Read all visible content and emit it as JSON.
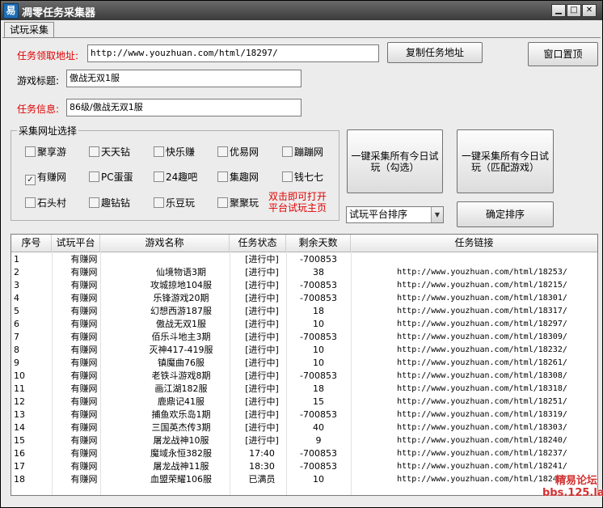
{
  "window": {
    "title": "凋零任务采集器",
    "app_icon_glyph": "易"
  },
  "tabs": [
    {
      "label": "试玩采集"
    }
  ],
  "form": {
    "task_url_label": "任务领取地址:",
    "task_url_value": "http://www.youzhuan.com/html/18297/",
    "copy_task_url_button": "复制任务地址",
    "window_topmost_button": "窗口置顶",
    "game_title_label": "游戏标题:",
    "game_title_value": "傲战无双1服",
    "task_info_label": "任务信息:",
    "task_info_value": "86级/傲战无双1服"
  },
  "site_group": {
    "title": "采集网址选择",
    "checkboxes": [
      {
        "label": "聚享游",
        "checked": false
      },
      {
        "label": "天天钻",
        "checked": false
      },
      {
        "label": "快乐赚",
        "checked": false
      },
      {
        "label": "优易网",
        "checked": false
      },
      {
        "label": "蹦蹦网",
        "checked": false
      },
      {
        "label": "有赚网",
        "checked": true
      },
      {
        "label": "PC蛋蛋",
        "checked": false
      },
      {
        "label": "24趣吧",
        "checked": false
      },
      {
        "label": "集趣网",
        "checked": false
      },
      {
        "label": "钱七七",
        "checked": false
      },
      {
        "label": "石头村",
        "checked": false
      },
      {
        "label": "趣钻钻",
        "checked": false
      },
      {
        "label": "乐豆玩",
        "checked": false
      },
      {
        "label": "聚聚玩",
        "checked": false
      }
    ],
    "hint_line1": "双击即可打开",
    "hint_line2": "平台试玩主页"
  },
  "actions": {
    "collect_checked_line1": "一键采集所有今日试",
    "collect_checked_line2": "玩（勾选）",
    "collect_matched_line1": "一键采集所有今日试",
    "collect_matched_line2": "玩（匹配游戏）",
    "sort_select_value": "试玩平台排序",
    "confirm_sort_button": "确定排序"
  },
  "table": {
    "columns": [
      "序号",
      "试玩平台",
      "游戏名称",
      "任务状态",
      "剩余天数",
      "任务链接"
    ],
    "rows": [
      [
        "1",
        "有赚网",
        "",
        "[进行中]",
        "-700853",
        ""
      ],
      [
        "2",
        "有赚网",
        "仙境物语3期",
        "[进行中]",
        "38",
        "http://www.youzhuan.com/html/18253/"
      ],
      [
        "3",
        "有赚网",
        "攻城掠地104服",
        "[进行中]",
        "-700853",
        "http://www.youzhuan.com/html/18215/"
      ],
      [
        "4",
        "有赚网",
        "乐锋游戏20期",
        "[进行中]",
        "-700853",
        "http://www.youzhuan.com/html/18301/"
      ],
      [
        "5",
        "有赚网",
        "幻想西游187服",
        "[进行中]",
        "18",
        "http://www.youzhuan.com/html/18317/"
      ],
      [
        "6",
        "有赚网",
        "傲战无双1服",
        "[进行中]",
        "10",
        "http://www.youzhuan.com/html/18297/"
      ],
      [
        "7",
        "有赚网",
        "佰乐斗地主3期",
        "[进行中]",
        "-700853",
        "http://www.youzhuan.com/html/18309/"
      ],
      [
        "8",
        "有赚网",
        "灭神417-419服",
        "[进行中]",
        "10",
        "http://www.youzhuan.com/html/18232/"
      ],
      [
        "9",
        "有赚网",
        "镇魔曲76服",
        "[进行中]",
        "10",
        "http://www.youzhuan.com/html/18261/"
      ],
      [
        "10",
        "有赚网",
        "老铁斗游戏8期",
        "[进行中]",
        "-700853",
        "http://www.youzhuan.com/html/18308/"
      ],
      [
        "11",
        "有赚网",
        "画江湖182服",
        "[进行中]",
        "18",
        "http://www.youzhuan.com/html/18318/"
      ],
      [
        "12",
        "有赚网",
        "鹿鼎记41服",
        "[进行中]",
        "15",
        "http://www.youzhuan.com/html/18251/"
      ],
      [
        "13",
        "有赚网",
        "捕鱼欢乐岛1期",
        "[进行中]",
        "-700853",
        "http://www.youzhuan.com/html/18319/"
      ],
      [
        "14",
        "有赚网",
        "三国英杰传3期",
        "[进行中]",
        "40",
        "http://www.youzhuan.com/html/18303/"
      ],
      [
        "15",
        "有赚网",
        "屠龙战神10服",
        "[进行中]",
        "9",
        "http://www.youzhuan.com/html/18240/"
      ],
      [
        "16",
        "有赚网",
        "魔域永恒382服",
        "17:40",
        "-700853",
        "http://www.youzhuan.com/html/18237/"
      ],
      [
        "17",
        "有赚网",
        "屠龙战神11服",
        "18:30",
        "-700853",
        "http://www.youzhuan.com/html/18241/"
      ],
      [
        "18",
        "有赚网",
        "血盟荣耀106服",
        "已满员",
        "10",
        "http://www.youzhuan.com/html/18242/"
      ]
    ]
  },
  "watermark": {
    "line1": "精易论坛",
    "line2": "bbs.125.la"
  },
  "colors": {
    "label_red": "#e00000",
    "title_bar": "#3a3a3a"
  }
}
